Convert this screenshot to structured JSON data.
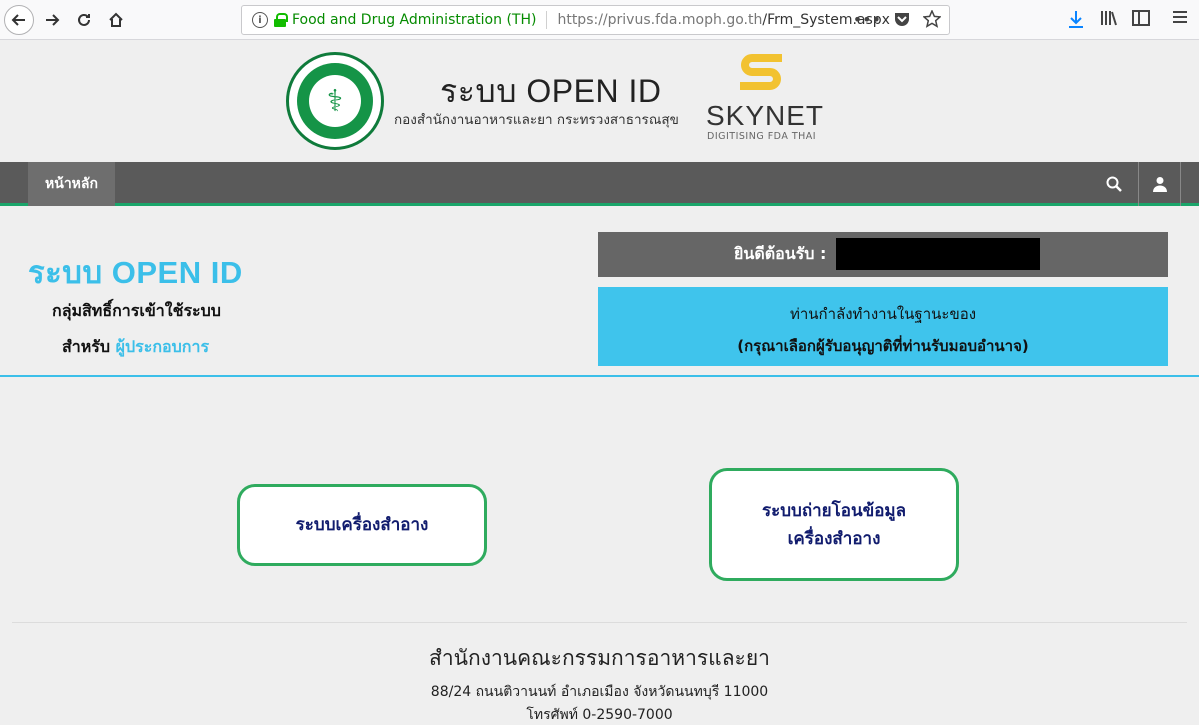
{
  "browser": {
    "site_identity": "Food and Drug Administration (TH)",
    "url_host": "https://privus.fda.moph.go.th",
    "url_path": "/Frm_System.aspx",
    "more_label": "•••"
  },
  "header": {
    "title": "ระบบ OPEN ID",
    "subtitle": "กองสำนักงานอาหารและยา กระทรวงสาธารณสุข",
    "skynet_name": "SKYNET",
    "skynet_tagline": "DIGITISING FDA THAI"
  },
  "nav": {
    "home_label": "หน้าหลัก"
  },
  "panel": {
    "system_title": "ระบบ OPEN ID",
    "permission_group_label": "กลุ่มสิทธิ์การเข้าใช้ระบบ",
    "for_label": "สำหรับ",
    "role": "ผู้ประกอบการ",
    "welcome_label": "ยินดีต้อนรับ :",
    "status_line1": "ท่านกำลังทำงานในฐานะของ",
    "status_line2": "(กรุณาเลือกผู้รับอนุญาติที่ท่านรับมอบอำนาจ)"
  },
  "systems": {
    "cosmetic": "ระบบเครื่องสำอาง",
    "transfer_line1": "ระบบถ่ายโอนข้อมูล",
    "transfer_line2": "เครื่องสำอาง"
  },
  "footer": {
    "org": "สำนักงานคณะกรรมการอาหารและยา",
    "address": "88/24 ถนนติวานนท์ อำเภอเมือง จังหวัดนนทบุรี 11000",
    "phone": "โทรศัพท์ 0-2590-7000"
  },
  "colors": {
    "accent_blue": "#3bbfe9",
    "button_green": "#2fab5e",
    "nav_gray": "#5a5a5a"
  }
}
